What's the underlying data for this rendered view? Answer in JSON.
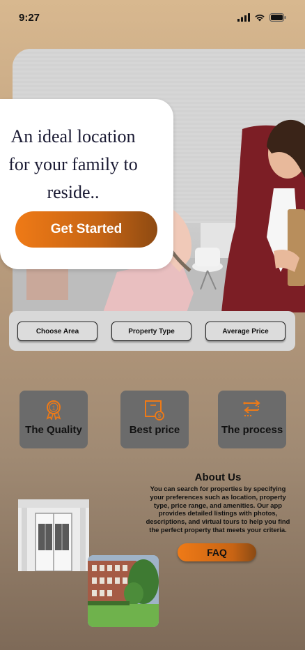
{
  "status_bar": {
    "time": "9:27"
  },
  "hero": {
    "headline": "An ideal location for your family to reside..",
    "cta_label": "Get Started"
  },
  "filters": [
    {
      "label": "Choose Area"
    },
    {
      "label": "Property Type"
    },
    {
      "label": "Average Price"
    }
  ],
  "features": [
    {
      "label": "The Quality",
      "icon": "award-ribbon-icon"
    },
    {
      "label": "Best price",
      "icon": "price-tag-icon"
    },
    {
      "label": "The process",
      "icon": "process-flow-icon"
    }
  ],
  "about": {
    "title": "About Us",
    "text": "You can search for properties by specifying your preferences such as location, property type, price range, and amenities. Our app provides detailed listings with photos, descriptions, and virtual tours to help you find the perfect property that meets your criteria.",
    "faq_label": "FAQ"
  },
  "colors": {
    "accent_orange": "#ef7a16",
    "accent_brown": "#8e4a12",
    "card_gray": "#6b6b6b",
    "filter_bg": "#d8d8d8"
  }
}
